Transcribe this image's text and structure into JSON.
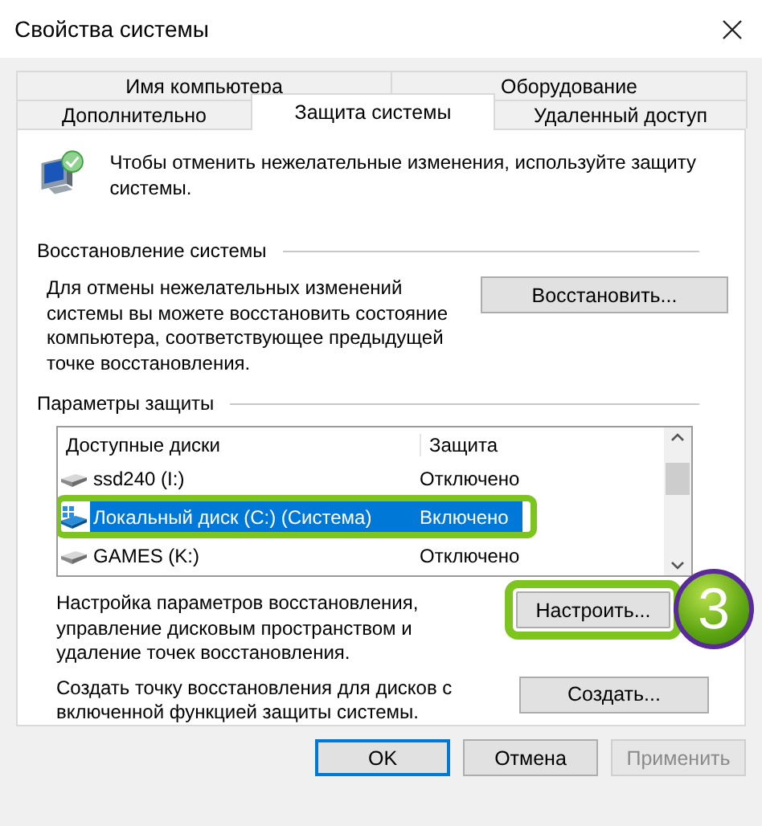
{
  "window": {
    "title": "Свойства системы"
  },
  "tab_rows": [
    {
      "tabs": [
        {
          "label": "Имя компьютера",
          "selected": false
        },
        {
          "label": "Оборудование",
          "selected": false
        }
      ]
    },
    {
      "tabs": [
        {
          "label": "Дополнительно",
          "selected": false
        },
        {
          "label": "Защита системы",
          "selected": true
        },
        {
          "label": "Удаленный доступ",
          "selected": false
        }
      ]
    }
  ],
  "intro": "Чтобы отменить нежелательные изменения, используйте защиту системы.",
  "restore_group": {
    "title": "Восстановление системы",
    "description": "Для отмены нежелательных изменений системы вы можете восстановить состояние компьютера, соответствующее предыдущей точке восстановления.",
    "button": {
      "label": "Восстановить...",
      "highlighted": false
    }
  },
  "protection_group": {
    "title": "Параметры защиты",
    "columns": [
      "Доступные диски",
      "Защита"
    ],
    "rows": [
      {
        "kind": "drive",
        "name": "ssd240 (I:)",
        "protection": "Отключено",
        "selected": false,
        "highlighted": false
      },
      {
        "kind": "system",
        "name": "Локальный диск (C:) (Система)",
        "protection": "Включено",
        "selected": true,
        "highlighted": true
      },
      {
        "kind": "drive",
        "name": "GAMES (K:)",
        "protection": "Отключено",
        "selected": false,
        "highlighted": false
      }
    ],
    "actions": [
      {
        "description": "Настройка параметров восстановления, управление дисковым пространством и удаление точек восстановления.",
        "button": {
          "label": "Настроить...",
          "highlighted": true,
          "step": "3"
        }
      },
      {
        "description": "Создать точку восстановления для дисков с включенной функцией защиты системы.",
        "button": {
          "label": "Создать...",
          "highlighted": false
        }
      }
    ]
  },
  "buttons": [
    {
      "label": "OK",
      "default": true,
      "disabled": false
    },
    {
      "label": "Отмена",
      "default": false,
      "disabled": false
    },
    {
      "label": "Применить",
      "default": false,
      "disabled": true
    }
  ]
}
